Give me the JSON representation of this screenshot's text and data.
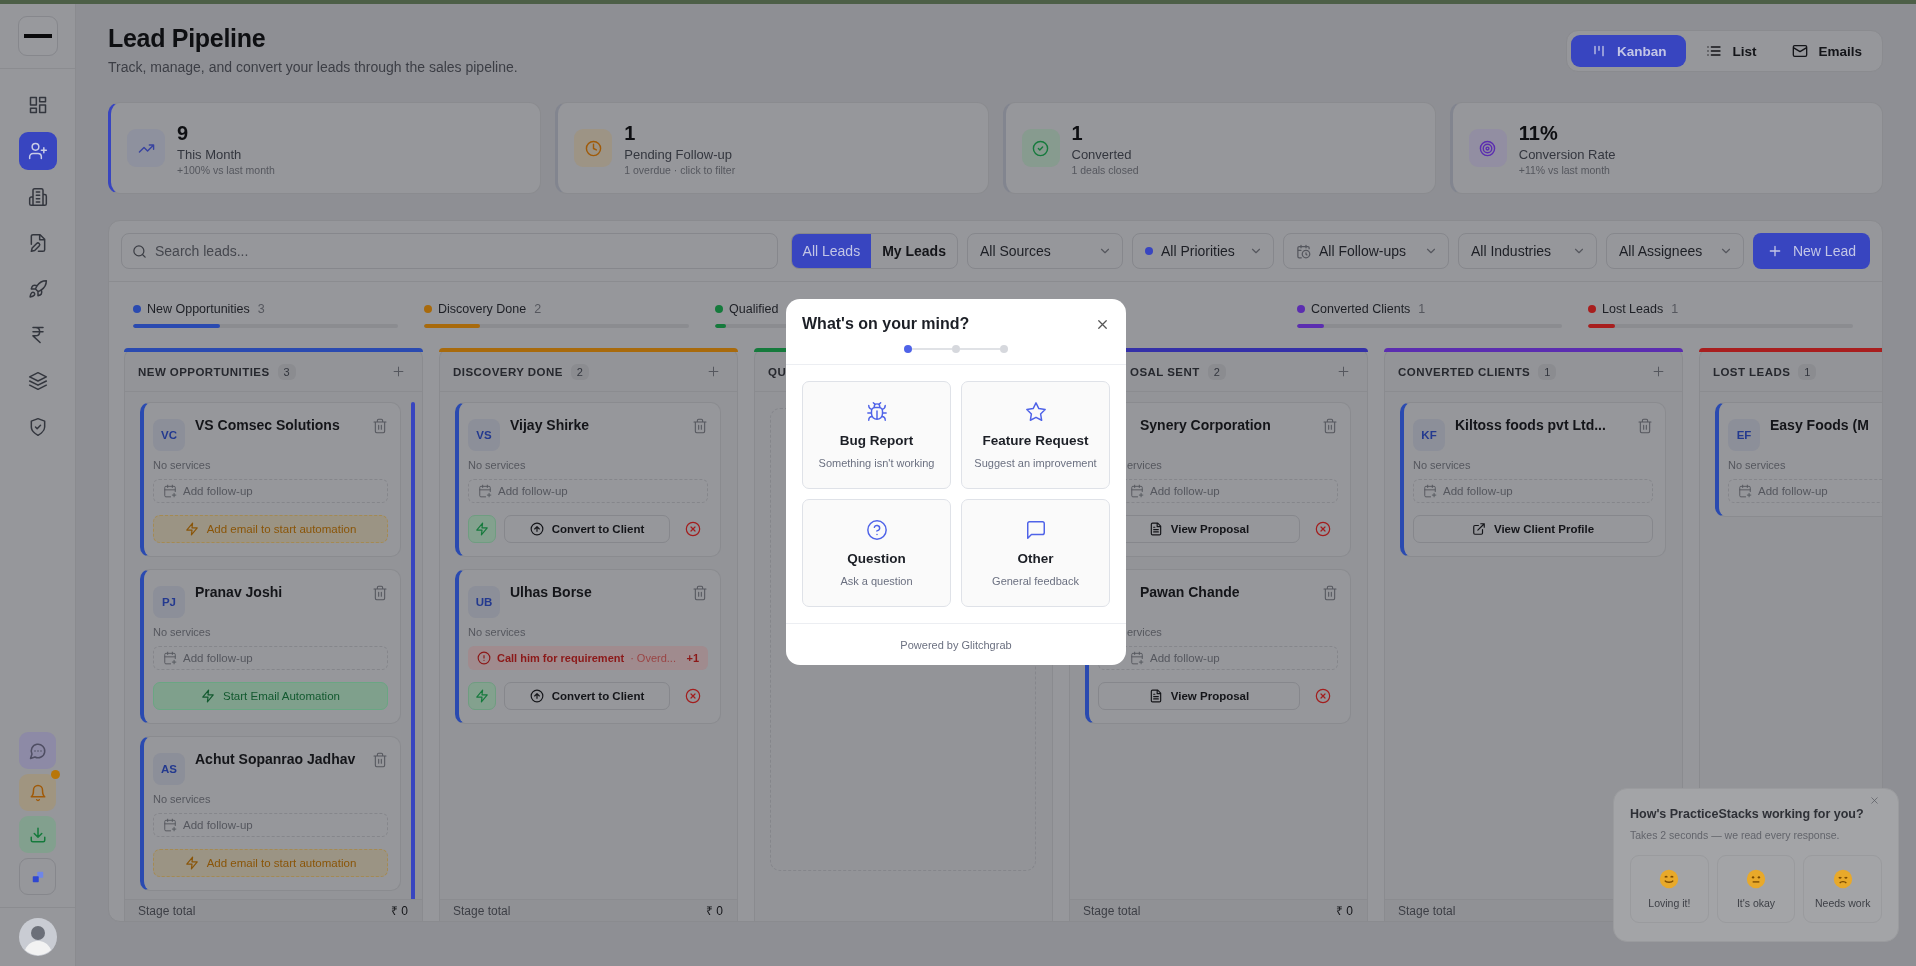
{
  "sidebar": {
    "nav": [
      {
        "selected": false
      },
      {
        "selected": true
      },
      {
        "selected": false
      },
      {
        "selected": false
      },
      {
        "selected": false
      },
      {
        "selected": false
      },
      {
        "selected": false
      },
      {
        "selected": false
      }
    ],
    "tools": [
      {
        "alert": false
      },
      {
        "alert": true
      },
      {
        "alert": false
      },
      {
        "alert": false
      }
    ]
  },
  "header": {
    "title": "Lead Pipeline",
    "subtitle": "Track, manage, and convert your leads through the sales pipeline."
  },
  "view_toggle": [
    {
      "label": "Kanban",
      "selected": true
    },
    {
      "label": "List",
      "selected": false
    },
    {
      "label": "Emails",
      "selected": false
    }
  ],
  "stats": [
    {
      "value": "9",
      "label": "This Month",
      "note": "+100% vs last month",
      "color": "#3843a0",
      "selected": true
    },
    {
      "value": "1",
      "label": "Pending Follow-up",
      "note": "1 overdue · click to filter",
      "color": "#a05a08",
      "selected": false
    },
    {
      "value": "1",
      "label": "Converted",
      "note": "1 deals closed",
      "color": "#157a3c",
      "selected": false
    },
    {
      "value": "11%",
      "label": "Conversion Rate",
      "note": "+11% vs last month",
      "color": "#5b2db0",
      "selected": false
    }
  ],
  "toolbar": {
    "search": {
      "placeholder": "Search leads..."
    },
    "scope": [
      {
        "label": "All Leads",
        "selected": true
      },
      {
        "label": "My Leads",
        "selected": false
      }
    ],
    "filters": [
      {
        "label": "All Sources",
        "kind": "plain"
      },
      {
        "label": "All Priorities",
        "kind": "dot"
      },
      {
        "label": "All Follow-ups",
        "kind": "calendar"
      },
      {
        "label": "All Industries",
        "kind": "plain"
      },
      {
        "label": "All Assignees",
        "kind": "plain"
      }
    ],
    "new_button": "New Lead"
  },
  "stages": [
    {
      "label": "New Opportunities",
      "count": "3",
      "color": "#2a4ab0",
      "level": 0.33
    },
    {
      "label": "Discovery Done",
      "count": "2",
      "color": "#a86a0c",
      "level": 0.21
    },
    {
      "label": "Qualified",
      "color": "#157a3c",
      "level": 0.04
    },
    {
      "label": "Converted Clients",
      "count": "1",
      "color": "#5b2db0",
      "level": 0.1
    },
    {
      "label": "Lost Leads",
      "count": "1",
      "color": "#a81e1e",
      "level": 0.1
    }
  ],
  "columns": [
    {
      "kind": "full",
      "title": "NEW OPPORTUNITIES",
      "count": "3",
      "color": "#2a4ab0",
      "add": true,
      "scrollable": true,
      "footer": {
        "label": "Stage total",
        "amount": "₹ 0"
      },
      "cards": [
        {
          "initials": "VC",
          "name": "VS Comsec Solutions",
          "services": "No services",
          "follow_up": {
            "kind": "add",
            "label": "Add follow-up"
          },
          "action": {
            "kind": "email_prompt",
            "label": "Add email to start automation"
          }
        },
        {
          "initials": "PJ",
          "name": "Pranav Joshi",
          "services": "No services",
          "follow_up": {
            "kind": "add",
            "label": "Add follow-up"
          },
          "action": {
            "kind": "email_start",
            "label": "Start Email Automation"
          }
        },
        {
          "initials": "AS",
          "name": "Achut Sopanrao Jadhav",
          "services": "No services",
          "follow_up": {
            "kind": "add",
            "label": "Add follow-up"
          },
          "action": {
            "kind": "email_prompt",
            "label": "Add email to start automation"
          }
        }
      ]
    },
    {
      "kind": "full",
      "title": "DISCOVERY DONE",
      "count": "2",
      "color": "#a86a0c",
      "add": true,
      "scrollable": false,
      "footer": {
        "label": "Stage total",
        "amount": "₹ 0"
      },
      "cards": [
        {
          "initials": "VS",
          "name": "Vijay Shirke",
          "services": "No services",
          "follow_up": {
            "kind": "add",
            "label": "Add follow-up"
          },
          "action": {
            "kind": "convert",
            "label": "Convert to Client"
          }
        },
        {
          "initials": "UB",
          "name": "Ulhas Borse",
          "services": "No services",
          "follow_up": {
            "kind": "overdue",
            "task": "Call him for requirement",
            "status": "· Overd...",
            "more": "+1"
          },
          "action": {
            "kind": "convert",
            "label": "Convert to Client"
          }
        }
      ]
    },
    {
      "kind": "empty",
      "title": "QU",
      "color": "#157a3c",
      "add": false,
      "scrollable": false
    },
    {
      "kind": "covered",
      "title": "OSAL SENT",
      "count": "2",
      "color": "#3430a8",
      "add": true,
      "scrollable": false,
      "footer": {
        "label": "Stage total",
        "amount": "₹ 0"
      },
      "cards": [
        {
          "name": "Synery Corporation",
          "services": "ervices",
          "follow_up": {
            "kind": "add",
            "label": "Add follow-up"
          },
          "action": {
            "kind": "proposal",
            "label": "View Proposal"
          }
        },
        {
          "name": "Pawan Chande",
          "services": "ervices",
          "follow_up": {
            "kind": "add",
            "label": "Add follow-up"
          },
          "action": {
            "kind": "proposal",
            "label": "View Proposal"
          }
        }
      ]
    },
    {
      "kind": "full",
      "title": "CONVERTED CLIENTS",
      "count": "1",
      "color": "#5b2db0",
      "add": true,
      "scrollable": false,
      "footer": {
        "label": "Stage total"
      },
      "cards": [
        {
          "initials": "KF",
          "name": "Kiltoss foods pvt Ltd...",
          "services": "No services",
          "follow_up": {
            "kind": "add",
            "label": "Add follow-up"
          },
          "action": {
            "kind": "profile",
            "label": "View Client Profile"
          }
        }
      ]
    },
    {
      "kind": "cut",
      "title": "LOST LEADS",
      "count": "1",
      "color": "#a81e1e",
      "add": false,
      "scrollable": false,
      "cards": [
        {
          "initials": "EF",
          "name": "Easy Foods (M",
          "services": "No services",
          "follow_up": {
            "kind": "add",
            "label": "Add follow-up"
          }
        }
      ]
    }
  ],
  "modal": {
    "title": "What's on your mind?",
    "steps": [
      {
        "selected": true
      },
      {
        "selected": false
      },
      {
        "selected": false
      }
    ],
    "options": [
      {
        "title": "Bug Report",
        "description": "Something isn't working"
      },
      {
        "title": "Feature Request",
        "description": "Suggest an improvement"
      },
      {
        "title": "Question",
        "description": "Ask a question"
      },
      {
        "title": "Other",
        "description": "General feedback"
      }
    ],
    "footer": "Powered by Glitchgrab"
  },
  "feedback": {
    "title": "How's PracticeStacks working for you?",
    "subtitle": "Takes 2 seconds — we read every response.",
    "options": [
      {
        "label": "Loving it!"
      },
      {
        "label": "It's okay"
      },
      {
        "label": "Needs work"
      }
    ]
  }
}
